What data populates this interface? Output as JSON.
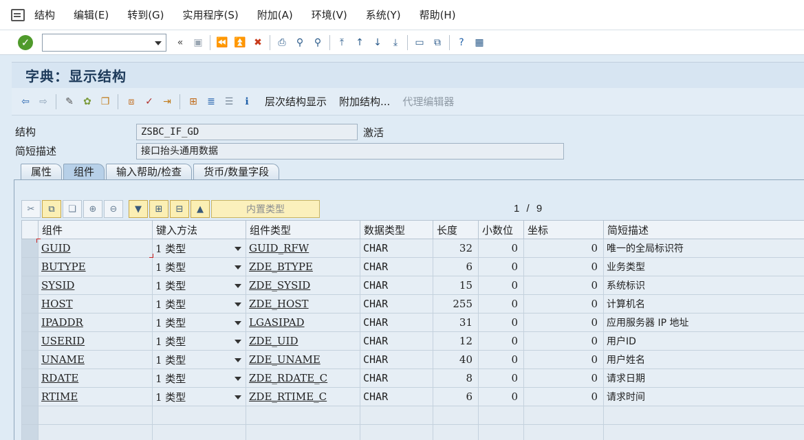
{
  "menu": [
    "结构",
    "编辑(E)",
    "转到(G)",
    "实用程序(S)",
    "附加(A)",
    "环境(V)",
    "系统(Y)",
    "帮助(H)"
  ],
  "title": "字典：显示结构",
  "app_toolbar": {
    "hierarchy": "层次结构显示",
    "append": "附加结构...",
    "proxy_editor": "代理编辑器"
  },
  "header": {
    "structure_label": "结构",
    "structure_value": "ZSBC_IF_GD",
    "status": "激活",
    "short_desc_label": "简短描述",
    "short_desc_value": "接口抬头通用数据"
  },
  "tabs": [
    "属性",
    "组件",
    "输入帮助/检查",
    "货币/数量字段"
  ],
  "active_tab": "组件",
  "table_toolbar": {
    "builtin_type": "内置类型",
    "pager": "1 / 9"
  },
  "columns": [
    "组件",
    "键入方法",
    "组件类型",
    "数据类型",
    "长度",
    "小数位",
    "坐标",
    "简短描述"
  ],
  "rows": [
    {
      "comp": "GUID",
      "entry": "1 类型",
      "ctype": "GUID_RFW",
      "dtype": "CHAR",
      "len": "32",
      "dec": "0",
      "coord": "0",
      "desc": "唯一的全局标识符"
    },
    {
      "comp": "BUTYPE",
      "entry": "1 类型",
      "ctype": "ZDE_BTYPE",
      "dtype": "CHAR",
      "len": "6",
      "dec": "0",
      "coord": "0",
      "desc": "业务类型"
    },
    {
      "comp": "SYSID",
      "entry": "1 类型",
      "ctype": "ZDE_SYSID",
      "dtype": "CHAR",
      "len": "15",
      "dec": "0",
      "coord": "0",
      "desc": "系统标识"
    },
    {
      "comp": "HOST",
      "entry": "1 类型",
      "ctype": "ZDE_HOST",
      "dtype": "CHAR",
      "len": "255",
      "dec": "0",
      "coord": "0",
      "desc": "计算机名"
    },
    {
      "comp": "IPADDR",
      "entry": "1 类型",
      "ctype": "LGASIPAD",
      "dtype": "CHAR",
      "len": "31",
      "dec": "0",
      "coord": "0",
      "desc": "应用服务器 IP 地址"
    },
    {
      "comp": "USERID",
      "entry": "1 类型",
      "ctype": "ZDE_UID",
      "dtype": "CHAR",
      "len": "12",
      "dec": "0",
      "coord": "0",
      "desc": "用户ID"
    },
    {
      "comp": "UNAME",
      "entry": "1 类型",
      "ctype": "ZDE_UNAME",
      "dtype": "CHAR",
      "len": "40",
      "dec": "0",
      "coord": "0",
      "desc": "用户姓名"
    },
    {
      "comp": "RDATE",
      "entry": "1 类型",
      "ctype": "ZDE_RDATE_C",
      "dtype": "CHAR",
      "len": "8",
      "dec": "0",
      "coord": "0",
      "desc": "请求日期"
    },
    {
      "comp": "RTIME",
      "entry": "1 类型",
      "ctype": "ZDE_RTIME_C",
      "dtype": "CHAR",
      "len": "6",
      "dec": "0",
      "coord": "0",
      "desc": "请求时间"
    }
  ]
}
